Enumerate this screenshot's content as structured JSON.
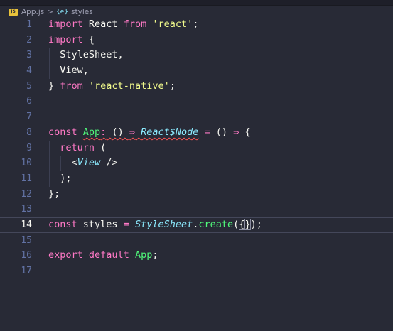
{
  "breadcrumb": {
    "file_icon_label": "JS",
    "file_name": "App.js",
    "separator": ">",
    "symbol_icon": "symbol-variable-icon",
    "symbol_glyph": "{e}",
    "symbol_name": "styles"
  },
  "lines": [
    {
      "n": "1",
      "current": false,
      "tokens": [
        [
          "kw",
          "import"
        ],
        [
          "plain",
          " React "
        ],
        [
          "kw",
          "from"
        ],
        [
          "plain",
          " "
        ],
        [
          "str",
          "'react'"
        ],
        [
          "plain",
          ";"
        ]
      ]
    },
    {
      "n": "2",
      "current": false,
      "tokens": [
        [
          "kw",
          "import"
        ],
        [
          "plain",
          " {"
        ]
      ]
    },
    {
      "n": "3",
      "current": false,
      "guide": true,
      "tokens": [
        [
          "plain",
          "  StyleSheet,"
        ]
      ]
    },
    {
      "n": "4",
      "current": false,
      "guide": true,
      "tokens": [
        [
          "plain",
          "  View,"
        ]
      ]
    },
    {
      "n": "5",
      "current": false,
      "tokens": [
        [
          "plain",
          "} "
        ],
        [
          "kw",
          "from"
        ],
        [
          "plain",
          " "
        ],
        [
          "str",
          "'react-native'"
        ],
        [
          "plain",
          ";"
        ]
      ]
    },
    {
      "n": "6",
      "current": false,
      "tokens": []
    },
    {
      "n": "7",
      "current": false,
      "tokens": []
    },
    {
      "n": "8",
      "current": false,
      "tokens": [
        [
          "kw",
          "const"
        ],
        [
          "plain",
          " "
        ],
        [
          "fn squiggle",
          "App"
        ],
        [
          "kw squiggle",
          ":"
        ],
        [
          "plain squiggle",
          " () "
        ],
        [
          "op squiggle",
          "⇒"
        ],
        [
          "plain squiggle",
          " "
        ],
        [
          "type squiggle",
          "React$Node"
        ],
        [
          "plain",
          " "
        ],
        [
          "op",
          "="
        ],
        [
          "plain",
          " () "
        ],
        [
          "op",
          "⇒"
        ],
        [
          "plain",
          " {"
        ]
      ]
    },
    {
      "n": "9",
      "current": false,
      "guide": true,
      "tokens": [
        [
          "plain",
          "  "
        ],
        [
          "kw",
          "return"
        ],
        [
          "plain",
          " ("
        ]
      ]
    },
    {
      "n": "10",
      "current": false,
      "guide": true,
      "guide2": true,
      "tokens": [
        [
          "plain",
          "    <"
        ],
        [
          "type",
          "View"
        ],
        [
          "plain",
          " />"
        ]
      ]
    },
    {
      "n": "11",
      "current": false,
      "guide": true,
      "tokens": [
        [
          "plain",
          "  );"
        ]
      ]
    },
    {
      "n": "12",
      "current": false,
      "tokens": [
        [
          "plain",
          "};"
        ]
      ]
    },
    {
      "n": "13",
      "current": false,
      "tokens": []
    },
    {
      "n": "14",
      "current": true,
      "tokens": [
        [
          "kw",
          "const"
        ],
        [
          "plain",
          " styles "
        ],
        [
          "op",
          "="
        ],
        [
          "plain",
          " "
        ],
        [
          "type",
          "StyleSheet"
        ],
        [
          "plain",
          "."
        ],
        [
          "fn",
          "create"
        ],
        [
          "plain",
          "("
        ],
        [
          "plain bracket-match",
          "{"
        ],
        [
          "cursor",
          ""
        ],
        [
          "plain bracket-match",
          "}"
        ],
        [
          "plain",
          ");"
        ]
      ]
    },
    {
      "n": "15",
      "current": false,
      "tokens": []
    },
    {
      "n": "16",
      "current": false,
      "tokens": [
        [
          "kw",
          "export"
        ],
        [
          "plain",
          " "
        ],
        [
          "kw",
          "default"
        ],
        [
          "plain",
          " "
        ],
        [
          "fn",
          "App"
        ],
        [
          "plain",
          ";"
        ]
      ]
    },
    {
      "n": "17",
      "current": false,
      "tokens": []
    }
  ]
}
